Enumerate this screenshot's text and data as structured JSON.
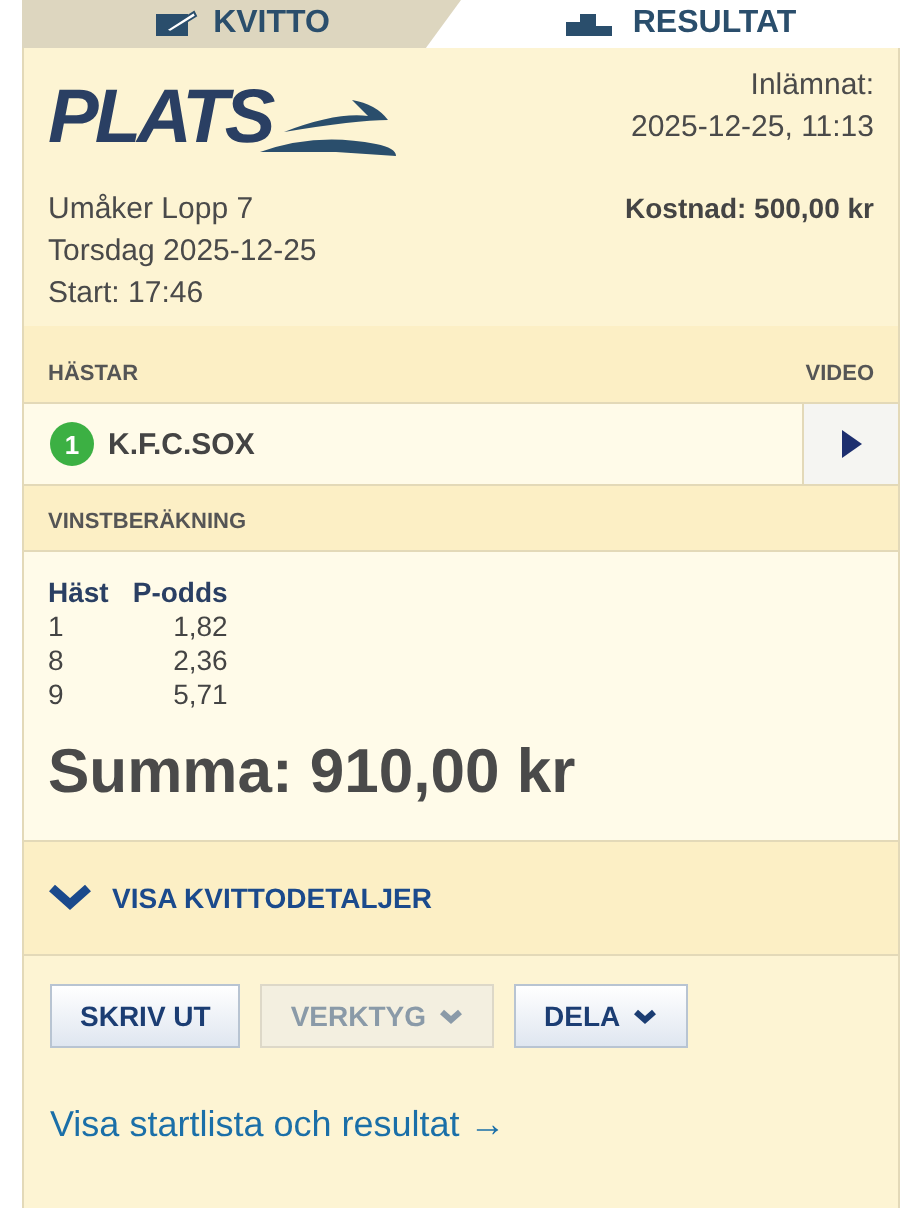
{
  "tabs": [
    {
      "label": "KVITTO",
      "selected": false
    },
    {
      "label": "RESULTAT",
      "selected": true
    }
  ],
  "logo": {
    "text": "PLATS"
  },
  "submitted": {
    "label": "Inlämnat:",
    "value": "2025-12-25, 11:13"
  },
  "race": {
    "track": "Umåker Lopp 7",
    "date": "Torsdag 2025-12-25",
    "start": "Start: 17:46",
    "cost": "Kostnad: 500,00 kr"
  },
  "horses": {
    "heading": "HÄSTAR",
    "video_heading": "VIDEO",
    "rows": [
      {
        "number": "1",
        "name": "K.F.C.SOX",
        "color": "#3cb043"
      }
    ]
  },
  "calculation": {
    "heading": "VINSTBERÄKNING",
    "columns": [
      "Häst",
      "P-odds"
    ],
    "rows": [
      [
        "1",
        "1,82"
      ],
      [
        "8",
        "2,36"
      ],
      [
        "9",
        "5,71"
      ]
    ],
    "total": "Summa: 910,00 kr"
  },
  "details_toggle": {
    "label": "VISA KVITTODETALJER",
    "expanded": false
  },
  "buttons": [
    {
      "label": "SKRIV UT",
      "dropdown": false,
      "disabled": false
    },
    {
      "label": "VERKTYG",
      "dropdown": true,
      "disabled": true
    },
    {
      "label": "DELA",
      "dropdown": true,
      "disabled": false
    }
  ],
  "link": {
    "label": "Visa startlista och resultat",
    "arrow": "→"
  }
}
